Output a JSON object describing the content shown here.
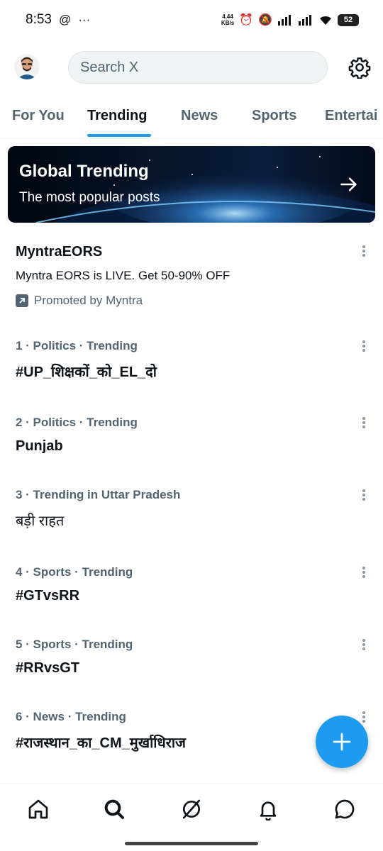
{
  "status_bar": {
    "time": "8:53",
    "speed_value": "4.44",
    "speed_unit": "KB/s",
    "battery": "52"
  },
  "search": {
    "placeholder": "Search X"
  },
  "tabs": [
    {
      "label": "For You"
    },
    {
      "label": "Trending"
    },
    {
      "label": "News"
    },
    {
      "label": "Sports"
    },
    {
      "label": "Entertai"
    }
  ],
  "banner": {
    "title": "Global Trending",
    "subtitle": "The most popular posts"
  },
  "promoted": {
    "title": "MyntraEORS",
    "description": "Myntra EORS is LIVE. Get 50-90% OFF",
    "by": "Promoted by Myntra"
  },
  "trends": [
    {
      "meta": "1 · Politics · Trending",
      "name": "#UP_शिक्षकों_को_EL_दो"
    },
    {
      "meta": "2 · Politics · Trending",
      "name": "Punjab"
    },
    {
      "meta": "3 · Trending in Uttar Pradesh",
      "name": "बड़ी राहत"
    },
    {
      "meta": "4 · Sports · Trending",
      "name": "#GTvsRR"
    },
    {
      "meta": "5 · Sports · Trending",
      "name": "#RRvsGT"
    },
    {
      "meta": "6 · News · Trending",
      "name": "#राजस्थान_का_CM_मुर्खाधिराज"
    }
  ],
  "colors": {
    "accent": "#1d9bf0",
    "text_primary": "#0f1419",
    "text_secondary": "#536471"
  },
  "icons": {
    "settings": "gear-icon",
    "banner_arrow": "arrow-right-icon",
    "compose": "plus-icon",
    "nav": [
      "home-icon",
      "search-icon",
      "grok-icon",
      "bell-icon",
      "messages-icon"
    ]
  }
}
